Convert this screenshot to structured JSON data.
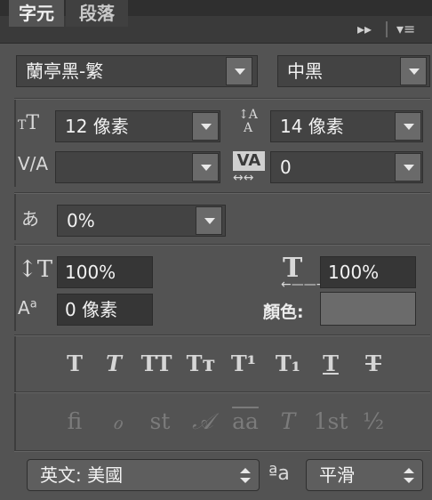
{
  "tabs": [
    "字元",
    "段落"
  ],
  "panel_menu": {
    "collapse": "▸▸",
    "menu": "▾≡"
  },
  "font_family": "蘭亭黑-繁",
  "font_style": "中黑",
  "font_size": "12 像素",
  "leading": "14 像素",
  "kerning": "",
  "tracking": "0",
  "tsume": "0%",
  "vertical_scale": "100%",
  "horizontal_scale": "100%",
  "baseline_shift": "0 像素",
  "color_label": "顏色:",
  "type_styles": [
    "T",
    "T",
    "TT",
    "Tт",
    "T¹",
    "T₁",
    "T",
    "T"
  ],
  "opentype_features": [
    "ﬁ",
    "ℴ",
    "st",
    "𝒜",
    "aa",
    "T",
    "1st",
    "½"
  ],
  "language": "英文: 美國",
  "aa_icon": "ªa",
  "antialias": "平滑",
  "icons": [
    "font-size-icon",
    "leading-icon",
    "kerning-icon",
    "tracking-icon",
    "tsume-icon",
    "vertical-scale-icon",
    "horizontal-scale-icon",
    "baseline-shift-icon"
  ],
  "colors": {
    "panel": "#535353",
    "field": "#434343",
    "input": "#363636",
    "text": "#f2f2f2"
  }
}
